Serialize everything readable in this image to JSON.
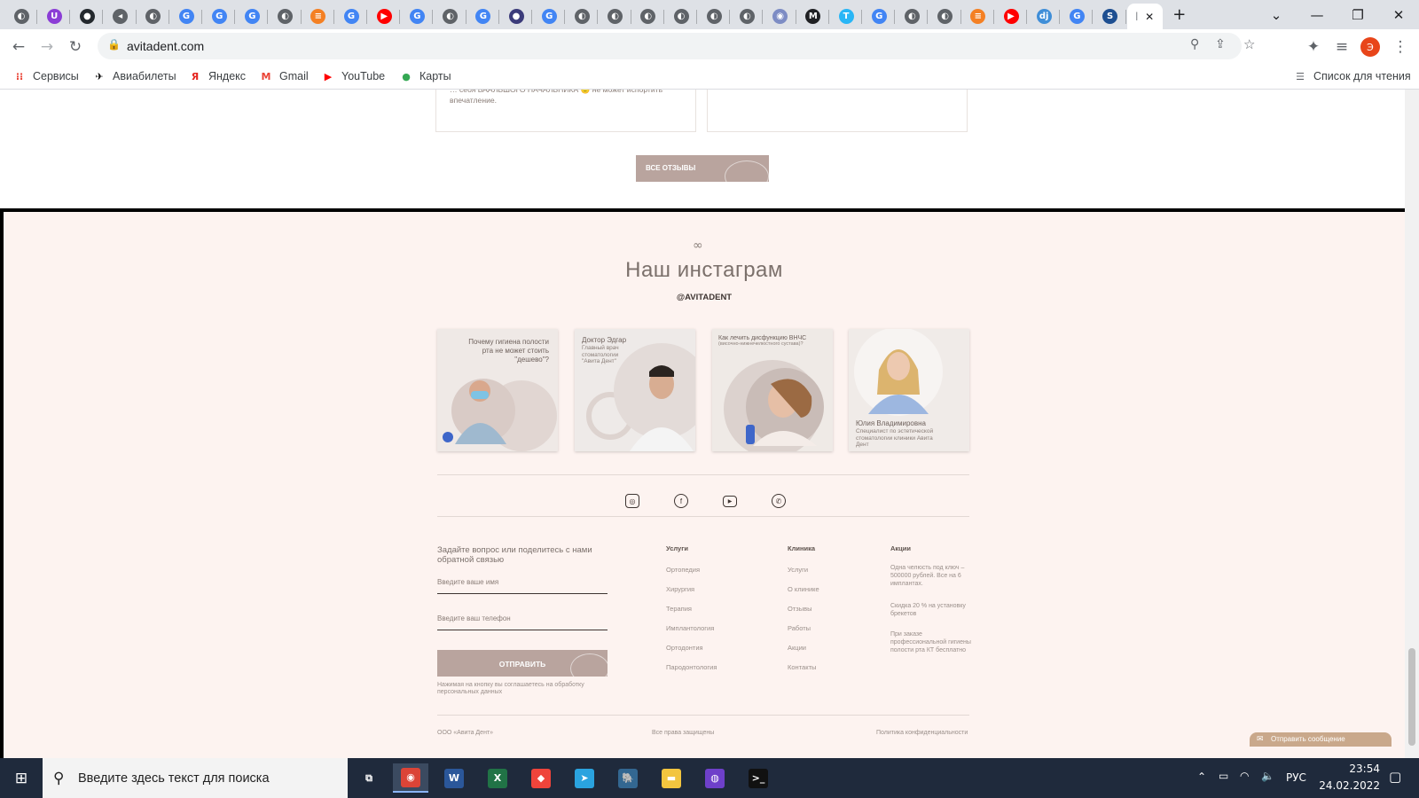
{
  "browser": {
    "tabs": [
      {
        "icon": "globe-icon",
        "glyph": "◐",
        "color": "#5f6368"
      },
      {
        "icon": "ublock-icon",
        "glyph": "U",
        "color": "#8b3dd6"
      },
      {
        "icon": "github-icon",
        "glyph": "●",
        "color": "#24292e"
      },
      {
        "icon": "audio-tab-icon",
        "glyph": "◂",
        "color": "#5f6368"
      },
      {
        "icon": "globe-icon",
        "glyph": "◐",
        "color": "#5f6368"
      },
      {
        "icon": "google-translate-icon",
        "glyph": "G",
        "color": "#4285f4"
      },
      {
        "icon": "google-icon",
        "glyph": "G",
        "color": "#4285f4"
      },
      {
        "icon": "google-icon",
        "glyph": "G",
        "color": "#4285f4"
      },
      {
        "icon": "globe-icon",
        "glyph": "◐",
        "color": "#5f6368"
      },
      {
        "icon": "stackoverflow-icon",
        "glyph": "≡",
        "color": "#f48024"
      },
      {
        "icon": "google-icon",
        "glyph": "G",
        "color": "#4285f4"
      },
      {
        "icon": "youtube-icon",
        "glyph": "▶",
        "color": "#ff0000"
      },
      {
        "icon": "google-icon",
        "glyph": "G",
        "color": "#4285f4"
      },
      {
        "icon": "globe-icon",
        "glyph": "◐",
        "color": "#5f6368"
      },
      {
        "icon": "google-icon",
        "glyph": "G",
        "color": "#4285f4"
      },
      {
        "icon": "avatar-tab-icon",
        "glyph": "●",
        "color": "#3b3b7a"
      },
      {
        "icon": "google-icon",
        "glyph": "G",
        "color": "#4285f4"
      },
      {
        "icon": "globe-icon",
        "glyph": "◐",
        "color": "#5f6368"
      },
      {
        "icon": "globe-icon",
        "glyph": "◐",
        "color": "#5f6368"
      },
      {
        "icon": "globe-icon",
        "glyph": "◐",
        "color": "#5f6368"
      },
      {
        "icon": "globe-icon",
        "glyph": "◐",
        "color": "#5f6368"
      },
      {
        "icon": "globe-icon",
        "glyph": "◐",
        "color": "#5f6368"
      },
      {
        "icon": "globe-icon",
        "glyph": "◐",
        "color": "#5f6368"
      },
      {
        "icon": "site-tab-icon",
        "glyph": "◉",
        "color": "#7d8cc4"
      },
      {
        "icon": "medium-icon",
        "glyph": "M",
        "color": "#202124"
      },
      {
        "icon": "trello-icon",
        "glyph": "T",
        "color": "#29b6f6"
      },
      {
        "icon": "google-icon",
        "glyph": "G",
        "color": "#4285f4"
      },
      {
        "icon": "globe-icon",
        "glyph": "◐",
        "color": "#5f6368"
      },
      {
        "icon": "globe-icon",
        "glyph": "◐",
        "color": "#5f6368"
      },
      {
        "icon": "stackoverflow-icon",
        "glyph": "≡",
        "color": "#f48024"
      },
      {
        "icon": "youtube-icon",
        "glyph": "▶",
        "color": "#ff0000"
      },
      {
        "icon": "django-icon",
        "glyph": "dj",
        "color": "#3f8ed8"
      },
      {
        "icon": "google-icon",
        "glyph": "G",
        "color": "#4285f4"
      },
      {
        "icon": "docs-tab-icon",
        "glyph": "S",
        "color": "#1e4f91"
      }
    ],
    "new_tab": "+",
    "url": "avitadent.com",
    "profile_initial": "Э",
    "bookmarks": [
      {
        "label": "Сервисы",
        "icon": "apps-grid-icon",
        "glyph": "⁝⁝",
        "color": "#ea4335"
      },
      {
        "label": "Авиабилеты",
        "icon": "plane-icon",
        "glyph": "✈",
        "color": "#000"
      },
      {
        "label": "Яндекс",
        "icon": "yandex-icon",
        "glyph": "Я",
        "color": "#e52620"
      },
      {
        "label": "Gmail",
        "icon": "gmail-icon",
        "glyph": "M",
        "color": "#ea4335"
      },
      {
        "label": "YouTube",
        "icon": "youtube-icon",
        "glyph": "▶",
        "color": "#ff0000"
      },
      {
        "label": "Карты",
        "icon": "maps-pin-icon",
        "glyph": "●",
        "color": "#34a853"
      }
    ],
    "reading_list": "Список для чтения"
  },
  "page": {
    "review_text": "… себя БААЛЬШОГО НАЧАЛЬНИКА 🙂 не может испортить впечатление.",
    "all_reviews": "ВСЕ ОТЗЫВЫ",
    "ornament": "∞",
    "instagram_title": "Наш инстаграм",
    "instagram_handle": "@AVITADENT",
    "posts": [
      {
        "text": "Почему гигиена полости рта не может стоить \"дешево\"?"
      },
      {
        "text": "Доктор Эдгар",
        "sub": "Главный врач стоматологии \"Авита Дент\""
      },
      {
        "text": "Как лечить дисфункцию ВНЧС",
        "sub": "(височно-нижнечелюстного сустава)?"
      },
      {
        "text": "Юлия Владимировна",
        "sub": "Специалист по эстетической стоматологии клиники Авита Дент"
      }
    ],
    "socials": [
      {
        "icon": "instagram-icon",
        "glyph": "◎"
      },
      {
        "icon": "facebook-icon",
        "glyph": "f"
      },
      {
        "icon": "youtube-icon",
        "glyph": "▶"
      },
      {
        "icon": "whatsapp-icon",
        "glyph": "✆"
      }
    ],
    "form": {
      "title": "Задайте вопрос или поделитесь с нами обратной связью",
      "name_placeholder": "Введите ваше имя",
      "phone_placeholder": "Введите ваш телефон",
      "submit": "ОТПРАВИТЬ",
      "consent": "Нажимая на кнопку вы соглашаетесь на обработку персональных данных"
    },
    "columns": {
      "services": {
        "heading": "Услуги",
        "items": [
          "Ортопедия",
          "Хирургия",
          "Терапия",
          "Имплантология",
          "Ортодонтия",
          "Пародонтология"
        ]
      },
      "clinic": {
        "heading": "Клиника",
        "items": [
          "Услуги",
          "О клинике",
          "Отзывы",
          "Работы",
          "Акции",
          "Контакты"
        ]
      },
      "promos": {
        "heading": "Акции",
        "items": [
          "Одна челюсть под ключ – 500000 рублей. Все на 6 имплантах.",
          "Скидка 20 % на установку брекетов",
          "При заказе профессиональной гигиены полости рта КТ бесплатно"
        ]
      }
    },
    "footer": {
      "company": "ООО «Авита Дент»",
      "rights": "Все права защищены",
      "privacy": "Политика конфиденциальности"
    },
    "chat_button": "Отправить сообщение"
  },
  "taskbar": {
    "search_placeholder": "Введите здесь текст для поиска",
    "apps": [
      {
        "icon": "task-view-icon",
        "glyph": "⧉",
        "color": "transparent"
      },
      {
        "icon": "chrome-icon",
        "glyph": "◉",
        "color": "#db4437"
      },
      {
        "icon": "word-icon",
        "glyph": "W",
        "color": "#2b579a"
      },
      {
        "icon": "excel-icon",
        "glyph": "X",
        "color": "#217346"
      },
      {
        "icon": "anydesk-icon",
        "glyph": "◆",
        "color": "#ef443b"
      },
      {
        "icon": "telegram-icon",
        "glyph": "➤",
        "color": "#2aa3df"
      },
      {
        "icon": "postgres-icon",
        "glyph": "🐘",
        "color": "#336791"
      },
      {
        "icon": "explorer-icon",
        "glyph": "▬",
        "color": "#f3c53f"
      },
      {
        "icon": "github-desktop-icon",
        "glyph": "◍",
        "color": "#6e40c9"
      },
      {
        "icon": "terminal-icon",
        "glyph": ">_",
        "color": "#111"
      }
    ],
    "language": "РУС",
    "time": "23:54",
    "date": "24.02.2022"
  }
}
